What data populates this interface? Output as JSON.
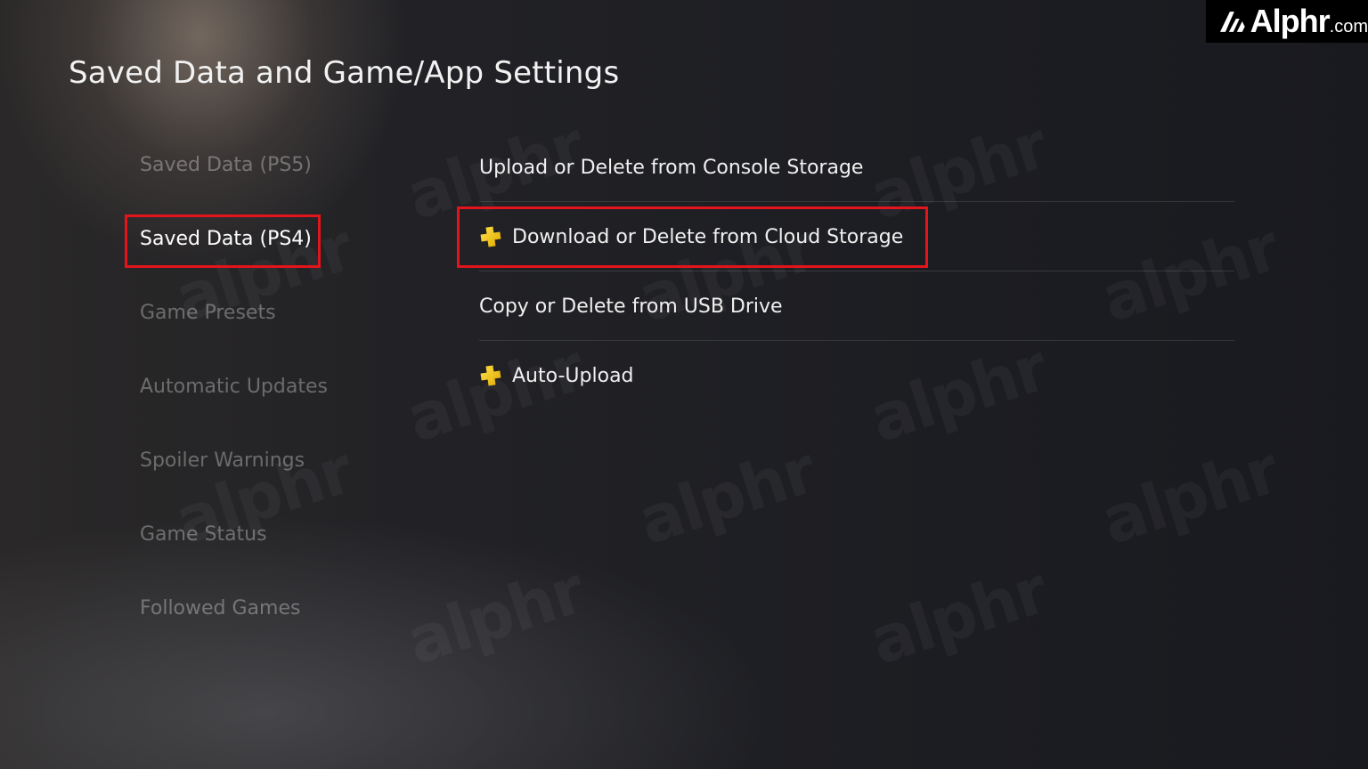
{
  "page": {
    "title": "Saved Data and Game/App Settings"
  },
  "brand": {
    "name": "Alphr",
    "suffix": ".com",
    "watermark_text": "alphr"
  },
  "sidebar": {
    "items": [
      {
        "label": "Saved Data (PS5)",
        "selected": false
      },
      {
        "label": "Saved Data (PS4)",
        "selected": true
      },
      {
        "label": "Game Presets",
        "selected": false
      },
      {
        "label": "Automatic Updates",
        "selected": false
      },
      {
        "label": "Spoiler Warnings",
        "selected": false
      },
      {
        "label": "Game Status",
        "selected": false
      },
      {
        "label": "Followed Games",
        "selected": false
      }
    ]
  },
  "menu": {
    "items": [
      {
        "label": "Upload or Delete from Console Storage",
        "icon": null
      },
      {
        "label": "Download or Delete from Cloud Storage",
        "icon": "ps-plus-icon"
      },
      {
        "label": "Copy or Delete from USB Drive",
        "icon": null
      },
      {
        "label": "Auto-Upload",
        "icon": "ps-plus-icon"
      }
    ]
  },
  "colors": {
    "highlight": "#e3141b",
    "ps_plus_gold": "#f5c400",
    "background": "#1f1f23"
  }
}
